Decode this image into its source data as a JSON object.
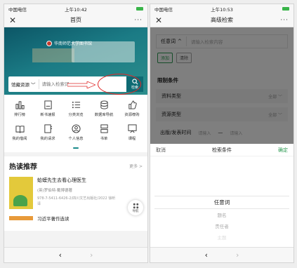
{
  "status_left": {
    "carrier": "中国电信",
    "time": "上午10:42"
  },
  "status_right": {
    "carrier": "中国电信",
    "time": "上午10:53"
  },
  "left": {
    "nav_title": "首页",
    "close": "✕",
    "more": "···",
    "banner_logo": "华南师范大学图书馆",
    "search": {
      "type": "馆藏资源",
      "placeholder": "请输入检索词",
      "button": "检索"
    },
    "grid": [
      {
        "label": "排行榜",
        "icon": "ranking-icon"
      },
      {
        "label": "新书速报",
        "icon": "new-books-icon"
      },
      {
        "label": "分类浏览",
        "icon": "category-list-icon"
      },
      {
        "label": "数据库导航",
        "icon": "database-icon"
      },
      {
        "label": "资源荐购",
        "icon": "thumbs-up-icon"
      },
      {
        "label": "我的借阅",
        "icon": "open-book-icon"
      },
      {
        "label": "我的请求",
        "icon": "request-icon"
      },
      {
        "label": "个人信息",
        "icon": "user-icon"
      },
      {
        "label": "书单",
        "icon": "booklist-icon"
      },
      {
        "label": "课程",
        "icon": "course-icon"
      }
    ],
    "section_title": "热读推荐",
    "section_more": "更多 >",
    "book1": {
      "title": "蛤蟆先生去看心理医生",
      "author": "(英)罗伯特·戴博德著",
      "publisher": "978-7-5411-6426-2/四川文艺出版社/2022 徐昕译"
    },
    "book2": {
      "title": "习近平著作选读"
    },
    "fab_label": "导航",
    "back": "‹",
    "forward": "›"
  },
  "right": {
    "nav_title": "高级检索",
    "close": "✕",
    "more": "···",
    "field_any": "任意词",
    "field_placeholder": "请输入检索内容",
    "add": "添加",
    "clear": "清除",
    "limits_title": "限制条件",
    "doc_type": "资料类型",
    "res_type": "资源类型",
    "all": "全部 ﹀",
    "pub_time": "出版/发表时间",
    "date_placeholder": "请输入",
    "dash": "—",
    "sheet": {
      "cancel": "取消",
      "title": "检索条件",
      "confirm": "确定",
      "options": [
        "任意词",
        "题名",
        "责任者",
        "主题"
      ]
    },
    "back": "‹",
    "forward": "›"
  }
}
